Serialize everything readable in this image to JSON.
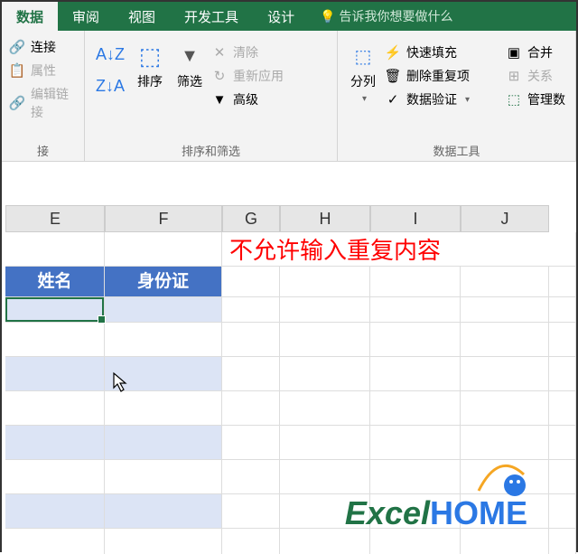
{
  "tabs": {
    "data": "数据",
    "review": "审阅",
    "view": "视图",
    "developer": "开发工具",
    "design": "设计",
    "tell_me": "告诉我你想要做什么"
  },
  "ribbon": {
    "connections": {
      "link": "连接",
      "props": "属性",
      "edit_links": "编辑链接",
      "group": "接"
    },
    "sort_filter": {
      "sort": "排序",
      "filter": "筛选",
      "clear": "清除",
      "reapply": "重新应用",
      "advanced": "高级",
      "group": "排序和筛选"
    },
    "data_tools": {
      "text_to_cols": "分列",
      "flash_fill": "快速填充",
      "remove_dup": "删除重复项",
      "data_valid": "数据验证",
      "consolidate": "合并",
      "relations": "关系",
      "manage": "管理数",
      "group": "数据工具"
    }
  },
  "columns": [
    "E",
    "F",
    "G",
    "H",
    "I",
    "J"
  ],
  "warning": "不允许输入重复内容",
  "table_headers": {
    "name": "姓名",
    "id": "身份证"
  },
  "logo": {
    "part1": "Excel",
    "part2": "HOME"
  }
}
